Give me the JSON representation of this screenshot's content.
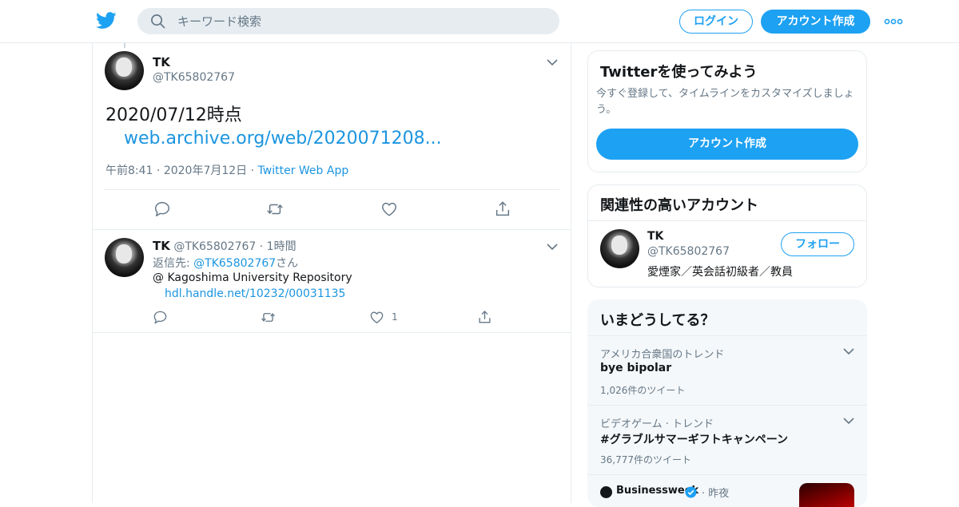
{
  "header": {
    "search_placeholder": "キーワード検索",
    "login_label": "ログイン",
    "signup_label": "アカウント作成"
  },
  "main_tweet": {
    "name": "TK",
    "handle": "@TK65802767",
    "text": "2020/07/12時点",
    "link": "web.archive.org/web/2020071208...",
    "time": "午前8:41",
    "date": "2020年7月12日",
    "source": "Twitter Web App",
    "sep": "·"
  },
  "reply_tweet": {
    "name": "TK",
    "handle": "@TK65802767",
    "sep": "·",
    "time": "1時間",
    "reply_prefix": "返信先: ",
    "reply_to": "@TK65802767",
    "reply_suffix": "さん",
    "text": "@ Kagoshima University Repository",
    "link": "hdl.handle.net/10232/00031135",
    "like_count": "1"
  },
  "signup_card": {
    "title": "Twitterを使ってみよう",
    "description": "今すぐ登録して、タイムラインをカスタマイズしましょう。",
    "button": "アカウント作成"
  },
  "related_card": {
    "title": "関連性の高いアカウント",
    "name": "TK",
    "handle": "@TK65802767",
    "bio": "愛煙家／英会話初級者／教員",
    "follow": "フォロー"
  },
  "trends_card": {
    "title": "いまどうしてる？",
    "items": [
      {
        "context": "アメリカ合衆国のトレンド",
        "title": "bye bipolar",
        "count": "1,026件のツイート"
      },
      {
        "context": "ビデオゲーム · トレンド",
        "title": "#グラブルサマーギフトキャンペーン",
        "count": "36,777件のツイート"
      }
    ],
    "news": {
      "source": "Businessweek",
      "sep": "·",
      "time": "昨夜"
    }
  },
  "colors": {
    "accent": "#1da1f2",
    "link": "#1b95e0",
    "secondary_text": "#657786",
    "border": "#e6ecf0"
  }
}
